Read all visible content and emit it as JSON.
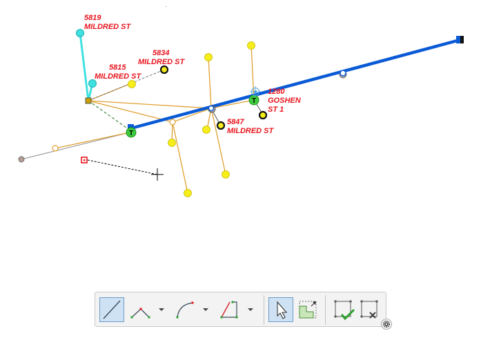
{
  "map": {
    "labels": [
      {
        "line1": "5819",
        "line2": "MILDRED ST"
      },
      {
        "line1": "5834",
        "line2": "MILDRED ST"
      },
      {
        "line1": "5815",
        "line2": "MILDRED ST"
      },
      {
        "line1": "1280",
        "line2": "GOSHEN",
        "line3": "ST 1"
      },
      {
        "line1": "5847",
        "line2": "MILDRED ST"
      }
    ],
    "transformer_marker": "T",
    "colors": {
      "primary_line": "#0a5ad6",
      "service_line": "#e0a030",
      "selected_line": "#3fe0e0",
      "meter": "#f5ee1a",
      "transformer": "#3ccc3c",
      "label": "#e8141c"
    }
  },
  "toolbar": {
    "tools": [
      {
        "name": "line-tool",
        "state": "active"
      },
      {
        "name": "segmented-tool"
      },
      {
        "name": "arc-tool"
      },
      {
        "name": "trace-tool"
      },
      {
        "name": "select-tool",
        "state": "active"
      },
      {
        "name": "reshape-tool"
      },
      {
        "name": "finish-tool"
      },
      {
        "name": "cancel-tool"
      }
    ]
  }
}
